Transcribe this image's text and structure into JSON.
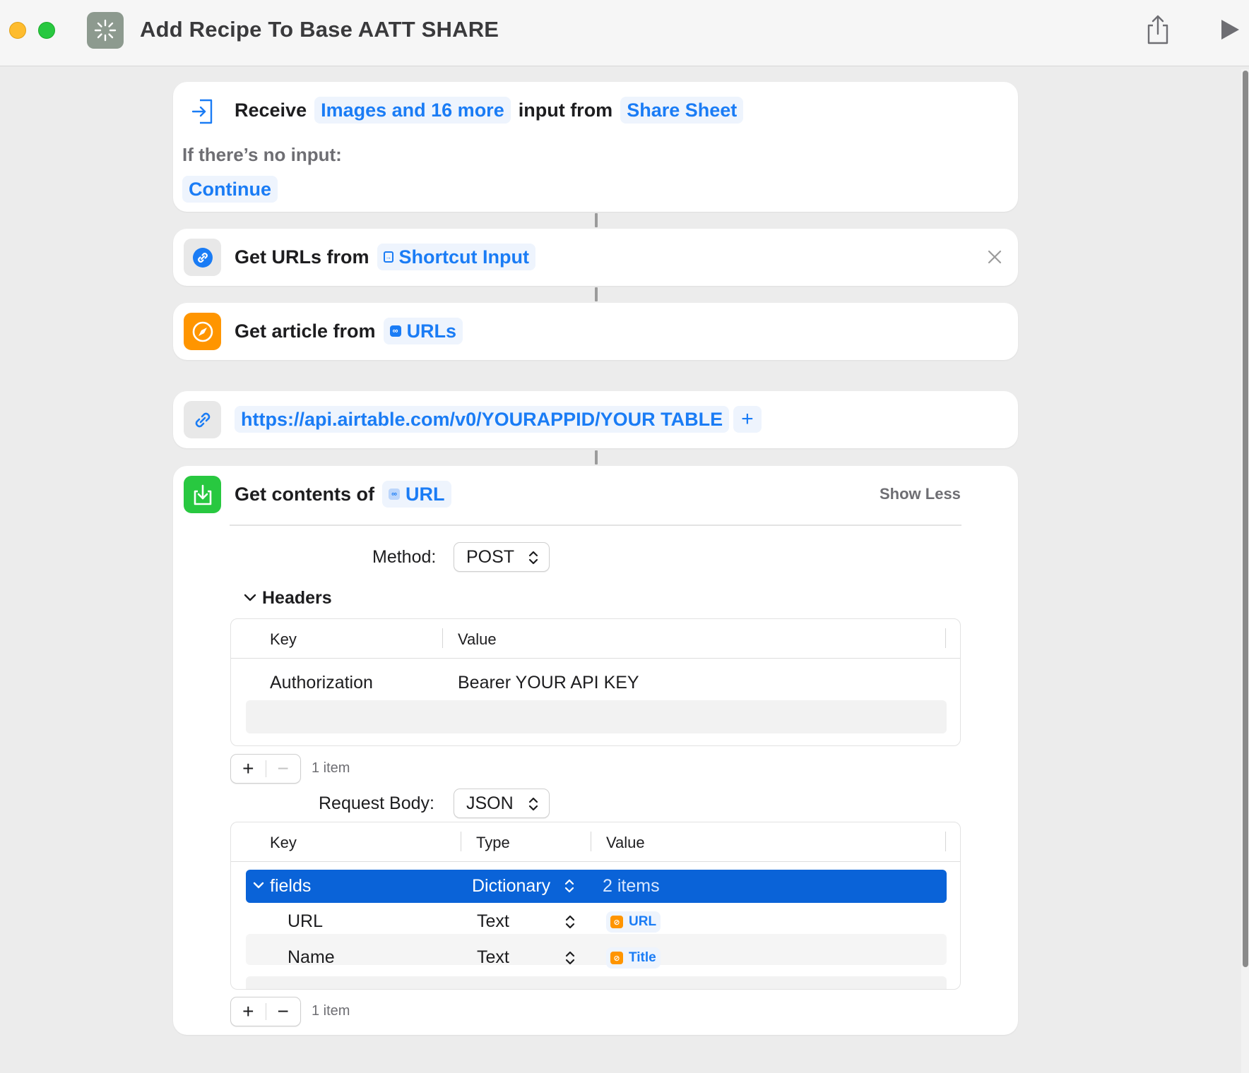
{
  "window": {
    "title": "Add Recipe To Base AATT SHARE",
    "app_icon": "shortcuts-sparkle-icon",
    "toolbar": {
      "share_icon": "share-icon",
      "run_icon": "play-icon"
    }
  },
  "actions": {
    "receive": {
      "verb": "Receive",
      "input_types": "Images and 16 more",
      "middle": "input from",
      "source": "Share Sheet",
      "no_input_label": "If there’s no input:",
      "no_input_action": "Continue"
    },
    "get_urls": {
      "verb": "Get URLs from",
      "input": "Shortcut Input"
    },
    "get_article": {
      "verb": "Get article from",
      "input": "URLs"
    },
    "url": {
      "value": "https://api.airtable.com/v0/YOURAPPID/YOUR TABLE",
      "add": "+"
    },
    "get_contents": {
      "verb": "Get contents of",
      "input": "URL",
      "toggle": "Show Less",
      "method_label": "Method:",
      "method_value": "POST",
      "headers_label": "Headers",
      "headers_table": {
        "columns": [
          "Key",
          "Value"
        ],
        "rows": [
          {
            "key": "Authorization",
            "value": "Bearer YOUR API KEY"
          }
        ],
        "count": "1 item"
      },
      "body_label": "Request Body:",
      "body_value": "JSON",
      "body_table": {
        "columns": [
          "Key",
          "Type",
          "Value"
        ],
        "group": {
          "key": "fields",
          "type": "Dictionary",
          "value": "2 items"
        },
        "rows": [
          {
            "key": "URL",
            "type": "Text",
            "value": "URL"
          },
          {
            "key": "Name",
            "type": "Text",
            "value": "Title"
          }
        ],
        "count": "1 item"
      }
    }
  },
  "colors": {
    "accent": "#1a7cf5",
    "selection": "#0a63d8",
    "safari_orange": "#ff9500",
    "green": "#28c840"
  }
}
